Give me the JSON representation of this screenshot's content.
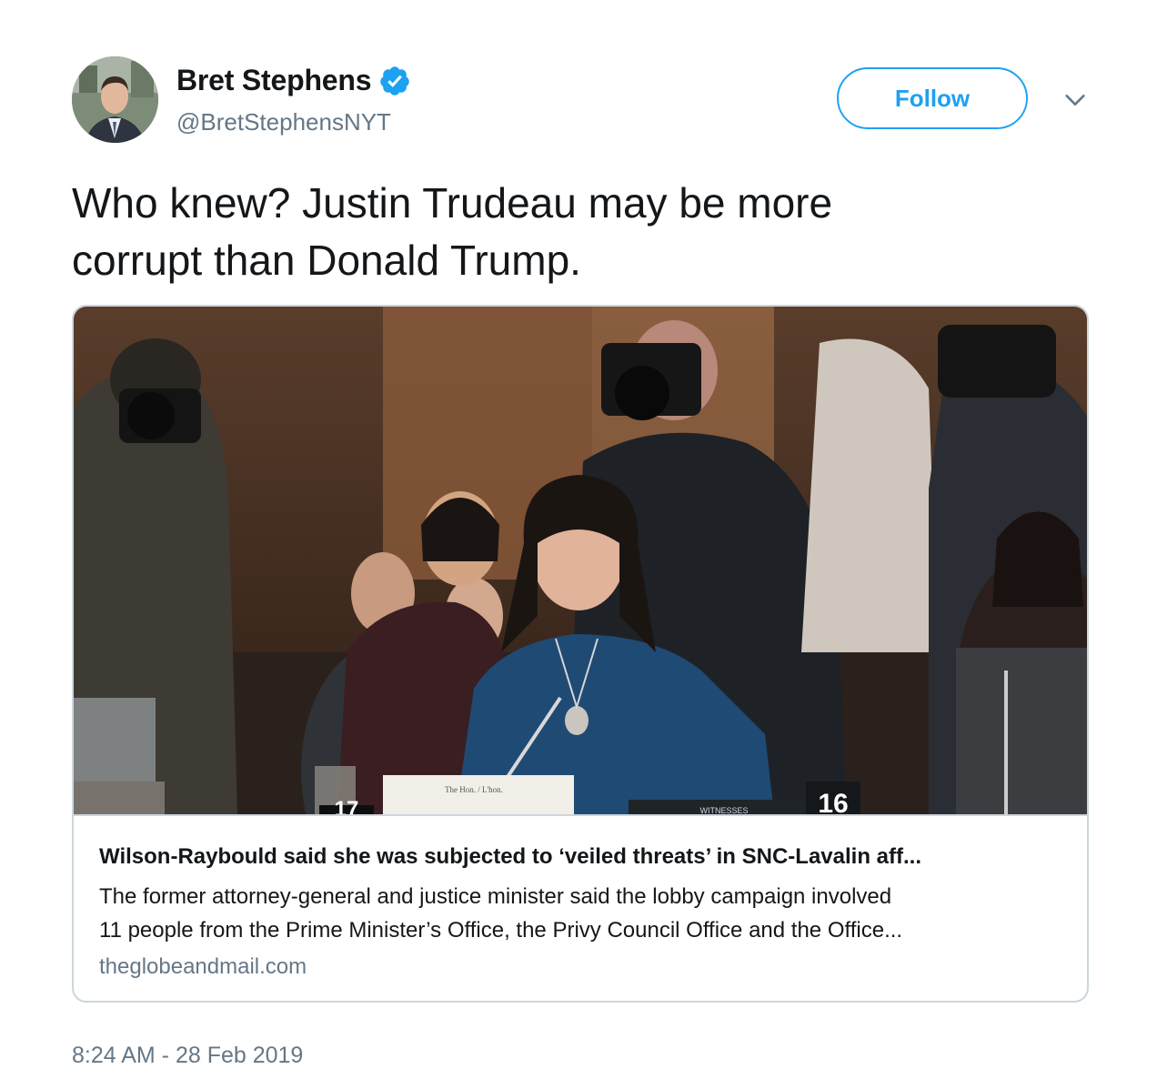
{
  "author": {
    "display_name": "Bret Stephens",
    "handle": "@BretStephensNYT",
    "verified": true,
    "avatar_icon": "profile-photo"
  },
  "follow_label": "Follow",
  "menu_icon": "chevron-down-icon",
  "tweet": {
    "text_line1": "Who knew? Justin Trudeau may be more",
    "text_line2": "corrupt than Donald Trump."
  },
  "card": {
    "title": "Wilson-Raybould said she was subjected to ‘veiled threats’ in SNC-Lavalin aff...",
    "description_line1": "The former attorney-general and justice minister said the lobby campaign involved",
    "description_line2": "11 people from the Prime Minister’s Office, the Privy Council Office and the Office...",
    "domain": "theglobeandmail.com",
    "image_signs": {
      "left_number": "17",
      "right_number": "16",
      "nameplate": "The Hon. / L'hon.",
      "witness_sign": "WITNESSES"
    }
  },
  "timestamp": "8:24 AM - 28 Feb 2019",
  "colors": {
    "accent": "#1da1f2",
    "text": "#14171a",
    "secondary": "#657786",
    "border": "#ccd6dd"
  }
}
